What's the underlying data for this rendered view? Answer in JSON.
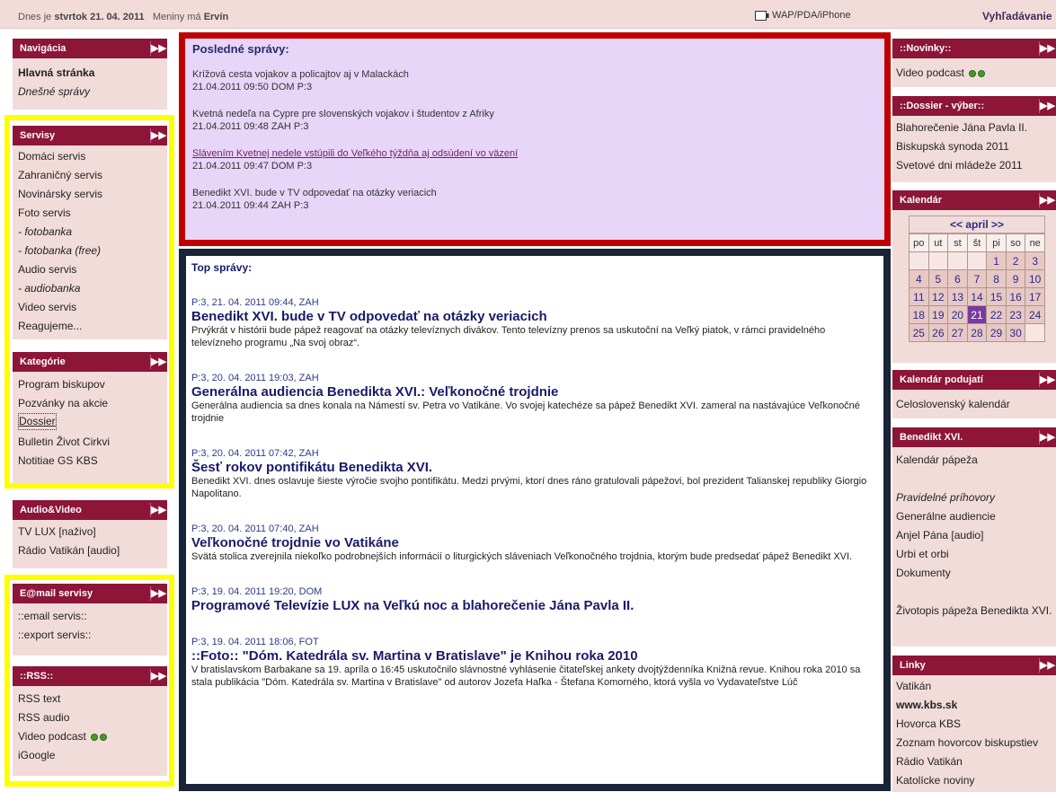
{
  "topbar": {
    "date_prefix": "Dnes je",
    "date": "stvrtok 21. 04. 2011",
    "nameday_prefix": "Meniny má",
    "nameday": "Ervín",
    "wap": "WAP/PDA/iPhone",
    "search": "Vyhľadávanie"
  },
  "left": {
    "navigacia": {
      "title": "Navigácia",
      "items": [
        "Hlavná stránka",
        "Dnešné správy"
      ]
    },
    "servisy": {
      "title": "Servisy",
      "items": [
        "Domáci servis",
        "Zahraničný servis",
        "Novinársky servis",
        "Foto servis",
        "- fotobanka",
        "- fotobanka (free)",
        "Audio servis",
        "- audiobanka",
        "Video servis",
        "Reagujeme..."
      ]
    },
    "kategorie": {
      "title": "Kategórie",
      "items": [
        "Program biskupov",
        "Pozvánky na akcie",
        "Dossier",
        "Bulletin Život Cirkvi",
        "Notitiae GS KBS"
      ]
    },
    "audiovideo": {
      "title": "Audio&Video",
      "items": [
        "TV LUX [naživo]",
        "Rádio Vatikán [audio]"
      ]
    },
    "email": {
      "title": "E@mail servisy",
      "items": [
        "::email servis::",
        "::export servis::"
      ]
    },
    "rss": {
      "title": "::RSS::",
      "items": [
        "RSS text",
        "RSS audio",
        "Video podcast",
        "iGoogle"
      ]
    }
  },
  "latest": {
    "title": "Posledné správy:",
    "items": [
      {
        "headline": "Krížová cesta vojakov a policajtov aj v Malackách",
        "meta": "21.04.2011 09:50 DOM P:3"
      },
      {
        "headline": "Kvetná nedeľa na Cypre pre slovenských vojakov i študentov z Afriky",
        "meta": "21.04.2011 09:48 ZAH P:3"
      },
      {
        "headline": "Slávením Kvetnej nedele vstúpili do Veľkého týždňa aj odsúdení vo väzení",
        "meta": "21.04.2011 09:47 DOM P:3"
      },
      {
        "headline": "Benedikt XVI. bude v TV odpovedať na otázky veriacich",
        "meta": "21.04.2011 09:44 ZAH P:3"
      }
    ]
  },
  "top": {
    "title": "Top správy:",
    "articles": [
      {
        "meta": "P:3, 21. 04. 2011 09:44, ZAH",
        "headline": "Benedikt XVI. bude v TV odpovedať na otázky veriacich",
        "text": "Prvýkrát v histórii bude pápež reagovať na otázky televíznych divákov. Tento televízny prenos sa uskutoční na Veľký piatok, v rámci pravidelného televízneho programu „Na svoj obraz“."
      },
      {
        "meta": "P:3, 20. 04. 2011 19:03, ZAH",
        "headline": "Generálna audiencia Benedikta XVI.: Veľkonočné trojdnie",
        "text": "Generálna audiencia sa dnes konala na Námestí sv. Petra vo Vatikáne. Vo svojej katechéze sa pápež Benedikt XVI. zameral na nastávajúce Veľkonočné trojdnie"
      },
      {
        "meta": "P:3, 20. 04. 2011 07:42, ZAH",
        "headline": "Šesť rokov pontifikátu Benedikta XVI.",
        "text": "Benedikt XVI. dnes oslavuje šieste výročie svojho pontifikátu. Medzi prvými, ktorí dnes ráno gratulovali pápežovi, bol prezident Talianskej republiky Giorgio Napolitano."
      },
      {
        "meta": "P:3, 20. 04. 2011 07:40, ZAH",
        "headline": "Veľkonočné trojdnie vo Vatikáne",
        "text": "Svätá stolica zverejnila niekoľko podrobnejších informácií o liturgických sláveniach Veľkonočného trojdnia, ktorým bude predsedať pápež Benedikt XVI."
      },
      {
        "meta": "P:3, 19. 04. 2011 19:20, DOM",
        "headline": "Programové Televízie LUX na Veľkú noc a blahorečenie Jána Pavla II.",
        "text": ""
      },
      {
        "meta": "P:3, 19. 04. 2011 18:06, FOT",
        "headline": "::Foto:: \"Dóm. Katedrála sv. Martina v Bratislave\" je Knihou roka 2010",
        "text": "V bratislavskom Barbakane sa 19. apríla o 16:45 uskutočnilo slávnostné vyhlásenie čitateľskej ankety dvojtýždenníka Knižná revue. Knihou roka 2010 sa stala publikácia \"Dóm. Katedrála sv. Martina v Bratislave\" od autorov Jozefa Haľka - Štefana Komorného, ktorá vyšla vo Vydavateľstve Lúč"
      }
    ]
  },
  "right": {
    "novinky": {
      "title": "::Novinky::",
      "items": [
        "Video podcast"
      ]
    },
    "dossier": {
      "title": "::Dossier - výber::",
      "items": [
        "Blahorečenie Jána Pavla II.",
        "Biskupská synoda 2011",
        "Svetové dni mládeže 2011"
      ]
    },
    "kalendar": {
      "title": "Kalendár",
      "month": "<< april >>",
      "days": [
        "po",
        "ut",
        "st",
        "št",
        "pi",
        "so",
        "ne"
      ],
      "weeks": [
        [
          "",
          "",
          "",
          "",
          "1",
          "2",
          "3"
        ],
        [
          "4",
          "5",
          "6",
          "7",
          "8",
          "9",
          "10"
        ],
        [
          "11",
          "12",
          "13",
          "14",
          "15",
          "16",
          "17"
        ],
        [
          "18",
          "19",
          "20",
          "21",
          "22",
          "23",
          "24"
        ],
        [
          "25",
          "26",
          "27",
          "28",
          "29",
          "30",
          ""
        ]
      ],
      "today": "21"
    },
    "podujatia": {
      "title": "Kalendár podujatí",
      "items": [
        "Celoslovenský kalendár"
      ]
    },
    "benedikt": {
      "title": "Benedikt XVI.",
      "items": [
        "Kalendár pápeža",
        "",
        "Pravidelné príhovory",
        "Generálne audiencie",
        "Anjel Pána [audio]",
        "Urbi et orbi",
        "Dokumenty",
        "",
        "Životopis pápeža Benedikta XVI."
      ]
    },
    "linky": {
      "title": "Linky",
      "items": [
        "Vatikán",
        "www.kbs.sk",
        "Hovorca KBS",
        "Zoznam hovorcov biskupstiev",
        "Rádio Vatikán",
        "Katolícke noviny"
      ]
    }
  }
}
